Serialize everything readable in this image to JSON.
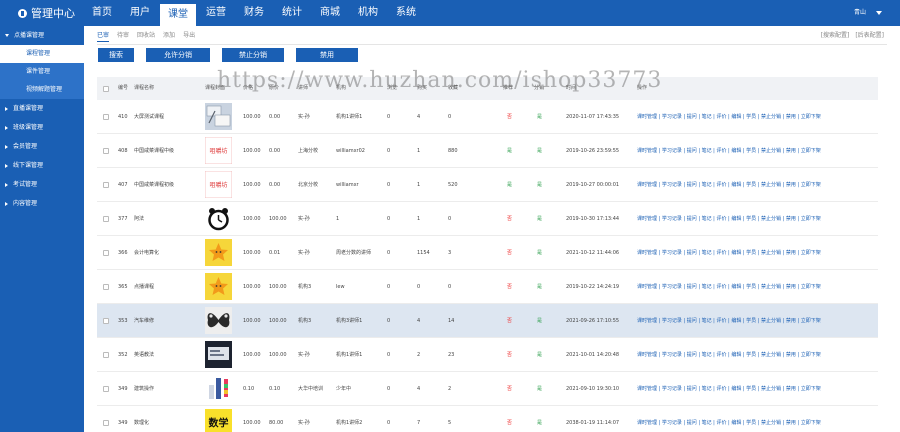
{
  "brand": "管理中心",
  "nav": [
    "首页",
    "用户",
    "课堂",
    "运营",
    "财务",
    "统计",
    "商城",
    "机构",
    "系统"
  ],
  "nav_active_index": 2,
  "user_name": "青山",
  "sidebar": [
    {
      "label": "点播课管理",
      "open": true,
      "items": [
        {
          "label": "课程管理",
          "active": true
        },
        {
          "label": "课件管理",
          "active": false
        },
        {
          "label": "视频解题管理",
          "active": false
        }
      ]
    },
    {
      "label": "直播课管理",
      "open": false
    },
    {
      "label": "班级课管理",
      "open": false
    },
    {
      "label": "会员管理",
      "open": false
    },
    {
      "label": "线下课管理",
      "open": false
    },
    {
      "label": "考试管理",
      "open": false
    },
    {
      "label": "内容管理",
      "open": false
    }
  ],
  "subtabs": [
    "已审",
    "待审",
    "回收站",
    "添加",
    "导出"
  ],
  "topright": [
    "[搜索配置]",
    "[后表配置]"
  ],
  "buttons": [
    "搜索",
    "允许分销",
    "禁止分销",
    "禁用"
  ],
  "watermark": "https://www.huzhan.com/ishop33773",
  "columns": [
    "编号",
    "课程名称",
    "课程封面",
    "价格",
    "原价",
    "讲师",
    "机构",
    "浏览",
    "购买",
    "收藏",
    "推荐",
    "分销",
    "状态",
    "时间",
    "操作"
  ],
  "actions_text": "课时管理 | 学习记录 | 提问 | 笔记 | 评价 | 编辑 | 学员 | 禁止分销 | 禁用 | 立即下架",
  "rows": [
    {
      "id": "410",
      "name": "大屏测试课程",
      "price": "100.00",
      "orig": "0.00",
      "teacher": "实-孙",
      "org": "机构1讲师1",
      "views": "0",
      "buy": "4",
      "fav": "0",
      "rec": "否",
      "dist": "是",
      "time": "2020-11-07 17:43:35",
      "thumb": "photo",
      "hl": false
    },
    {
      "id": "408",
      "name": "中国咸菜课程中级",
      "price": "100.00",
      "orig": "0.00",
      "teacher": "上海分校",
      "org": "williamxr02",
      "views": "0",
      "buy": "1",
      "fav": "880",
      "rec": "是",
      "dist": "是",
      "time": "2019-10-26 23:59:55",
      "thumb": "logo",
      "thumb_text": "咀嚼坊",
      "hl": false
    },
    {
      "id": "407",
      "name": "中国咸菜课程初级",
      "price": "100.00",
      "orig": "0.00",
      "teacher": "北京分校",
      "org": "williamxr",
      "views": "0",
      "buy": "1",
      "fav": "520",
      "rec": "是",
      "dist": "是",
      "time": "2019-10-27 00:00:01",
      "thumb": "logo",
      "thumb_text": "咀嚼坊",
      "hl": false
    },
    {
      "id": "377",
      "name": "阿法",
      "price": "100.00",
      "orig": "100.00",
      "teacher": "实-孙",
      "org": "1",
      "views": "0",
      "buy": "1",
      "fav": "0",
      "rec": "否",
      "dist": "是",
      "time": "2019-10-30 17:13:44",
      "thumb": "clock",
      "hl": false
    },
    {
      "id": "366",
      "name": "会计电算化",
      "price": "100.00",
      "orig": "0.01",
      "teacher": "实-孙",
      "org": "周老分数的讲师",
      "views": "0",
      "buy": "1154",
      "fav": "3",
      "rec": "否",
      "dist": "是",
      "time": "2021-10-12 11:44:06",
      "thumb": "star",
      "hl": false
    },
    {
      "id": "365",
      "name": "点播课程",
      "price": "100.00",
      "orig": "100.00",
      "teacher": "机构3",
      "org": "lew",
      "views": "0",
      "buy": "0",
      "fav": "0",
      "rec": "否",
      "dist": "是",
      "time": "2019-10-22 14:24:19",
      "thumb": "star",
      "hl": false
    },
    {
      "id": "353",
      "name": "汽车维修",
      "price": "100.00",
      "orig": "100.00",
      "teacher": "机构3",
      "org": "机构3讲师1",
      "views": "0",
      "buy": "4",
      "fav": "14",
      "rec": "否",
      "dist": "是",
      "time": "2021-09-26 17:10:55",
      "thumb": "butterfly",
      "hl": true
    },
    {
      "id": "352",
      "name": "英语教法",
      "price": "100.00",
      "orig": "100.00",
      "teacher": "实-孙",
      "org": "机构1讲师1",
      "views": "0",
      "buy": "2",
      "fav": "23",
      "rec": "否",
      "dist": "是",
      "time": "2021-10-01 14:20:48",
      "thumb": "screen",
      "hl": false
    },
    {
      "id": "349",
      "name": "建筑操作",
      "price": "0.10",
      "orig": "0.10",
      "teacher": "大华中培训",
      "org": "少年中",
      "views": "0",
      "buy": "4",
      "fav": "2",
      "rec": "否",
      "dist": "是",
      "time": "2021-09-10 19:30:10",
      "thumb": "person",
      "hl": false
    },
    {
      "id": "349",
      "name": "数理化",
      "price": "100.00",
      "orig": "80.00",
      "teacher": "实-孙",
      "org": "机构1讲师2",
      "views": "0",
      "buy": "7",
      "fav": "5",
      "rec": "否",
      "dist": "是",
      "time": "2038-01-19 11:14:07",
      "thumb": "text",
      "thumb_text": "数学",
      "hl": false
    }
  ]
}
